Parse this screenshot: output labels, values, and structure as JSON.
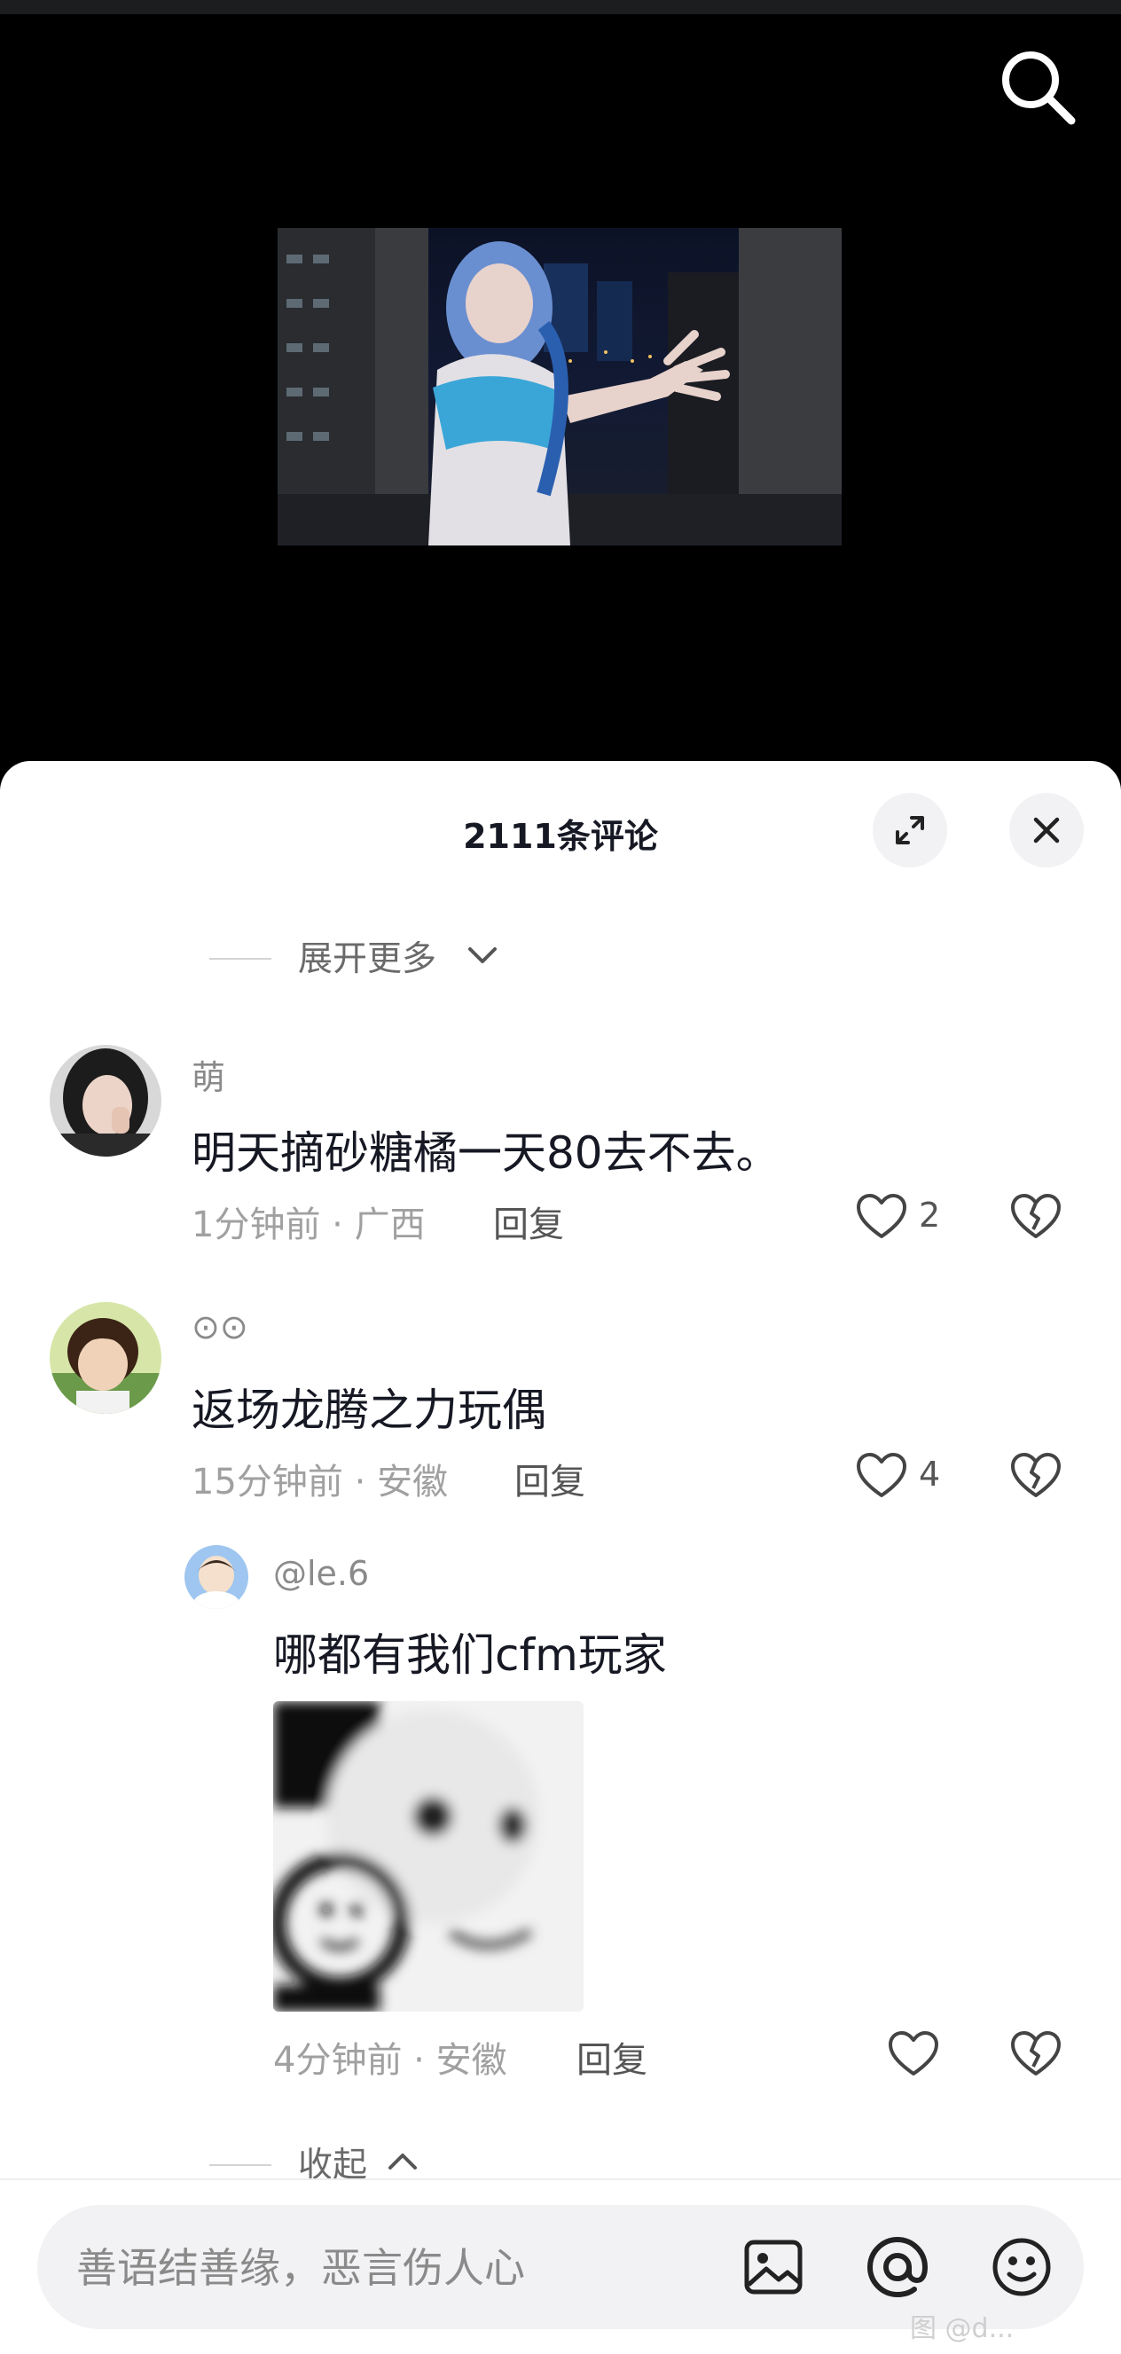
{
  "video": {
    "search_icon": "search-icon",
    "image_description": ""
  },
  "comments_panel": {
    "title": "2111条评论",
    "expand_icon": "expand-icon",
    "close_icon": "close-icon",
    "expand_more": "展开更多",
    "collapse": "收起",
    "comments": [
      {
        "username": "萌",
        "content": "明天摘砂糖橘一天80去不去。",
        "time_location": "1分钟前 · 广西",
        "reply_label": "回复",
        "likes": "2"
      },
      {
        "username": "⊙⊙",
        "content": "返场龙腾之力玩偶",
        "time_location": "15分钟前 · 安徽",
        "reply_label": "回复",
        "likes": "4",
        "replies": [
          {
            "username": "@le.6",
            "content": "哪都有我们cfm玩家",
            "time_location": "4分钟前 · 安徽",
            "reply_label": "回复",
            "likes": ""
          }
        ]
      }
    ]
  },
  "input_bar": {
    "placeholder": "善语结善缘，恶言伤人心",
    "icons": [
      "image-icon",
      "at-icon",
      "emoji-icon"
    ]
  },
  "watermark": "图 @d..."
}
